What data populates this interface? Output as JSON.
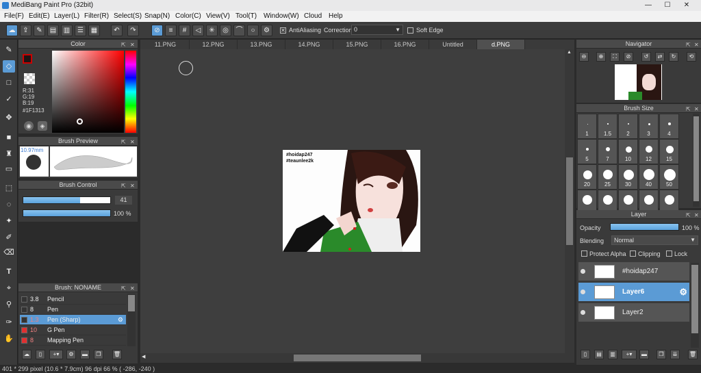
{
  "window": {
    "title": "MediBang Paint Pro (32bit)",
    "minimize": "—",
    "maximize": "☐",
    "close": "✕"
  },
  "menu": [
    "File(F)",
    "Edit(E)",
    "Layer(L)",
    "Filter(R)",
    "Select(S)",
    "Snap(N)",
    "Color(C)",
    "View(V)",
    "Tool(T)",
    "Window(W)",
    "Cloud",
    "Help"
  ],
  "toolbar": {
    "antialiasing_label": "AntiAliasing",
    "antialiasing_checked": true,
    "correction_label": "Correction",
    "correction_value": "0",
    "soft_edge_label": "Soft Edge",
    "soft_edge_checked": false
  },
  "color_panel": {
    "title": "Color",
    "r": "R:31",
    "g": "G:19",
    "b": "B:19",
    "hex": "#1F1313",
    "current_color": "#1f1313"
  },
  "brush_preview": {
    "title": "Brush Preview",
    "size": "10.97mm"
  },
  "brush_control": {
    "title": "Brush Control",
    "size_value": "41",
    "size_fraction": 0.65,
    "opacity_value": "100 %",
    "opacity_fraction": 1.0
  },
  "brush_list": {
    "title": "Brush: NONAME",
    "items": [
      {
        "size": "3.8",
        "name": "Pencil",
        "color": "#333333"
      },
      {
        "size": "8",
        "name": "Pen",
        "color": "#333333"
      },
      {
        "size": "1.3",
        "name": "Pen (Sharp)",
        "color": "#333333"
      },
      {
        "size": "10",
        "name": "G Pen",
        "color": "#e03030"
      },
      {
        "size": "8",
        "name": "Mapping Pen",
        "color": "#e03030"
      }
    ]
  },
  "tabs": [
    "11.PNG",
    "12.PNG",
    "13.PNG",
    "14.PNG",
    "15.PNG",
    "16.PNG",
    "Untitled",
    "d.PNG"
  ],
  "active_tab": 7,
  "artwork": {
    "line1": "#hoidap247",
    "line2": "#teaunlee2k"
  },
  "navigator": {
    "title": "Navigator"
  },
  "brush_size": {
    "title": "Brush Size",
    "sizes": [
      "1",
      "1.5",
      "2",
      "3",
      "4",
      "5",
      "7",
      "10",
      "12",
      "15",
      "20",
      "25",
      "30",
      "40",
      "50",
      "",
      "",
      "",
      "",
      ""
    ]
  },
  "layer_panel": {
    "title": "Layer",
    "opacity_label": "Opacity",
    "opacity_value": "100 %",
    "opacity_fraction": 1.0,
    "blending_label": "Blending",
    "blending_value": "Normal",
    "protect_alpha": "Protect Alpha",
    "clipping": "Clipping",
    "lock": "Lock",
    "layers": [
      {
        "name": "#hoidap247",
        "selected": false
      },
      {
        "name": "Layer6",
        "selected": true
      },
      {
        "name": "Layer2",
        "selected": false
      }
    ]
  },
  "status": "401 * 299 pixel  (10.6 * 7.9cm)  96 dpi  66 %  ( -286, -240 )",
  "colors": {
    "accent": "#5b9bd5",
    "panel": "#3a3a3a",
    "canvas_bg": "#3e3e3e"
  }
}
